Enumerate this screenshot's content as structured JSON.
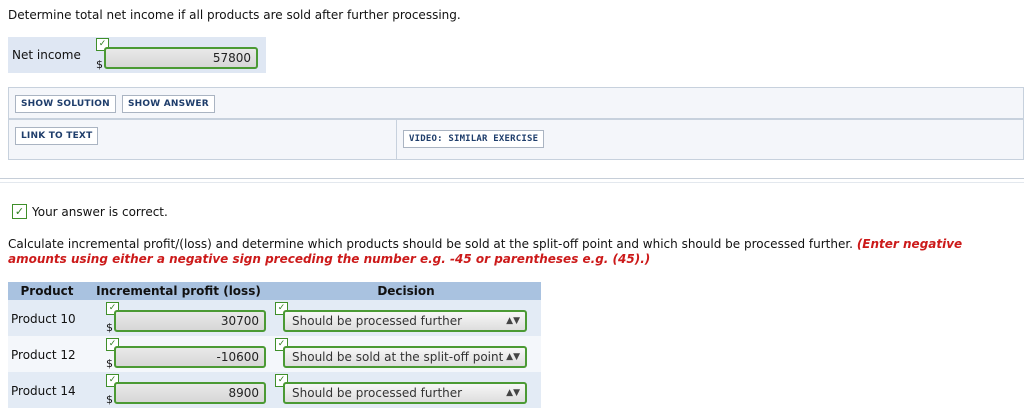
{
  "question1": "Determine total net income if all products are sold after further processing.",
  "net_income": {
    "label": "Net income",
    "currency": "$",
    "value": "57800"
  },
  "buttons": {
    "show_solution": "SHOW SOLUTION",
    "show_answer": "SHOW ANSWER",
    "link_to_text": "LINK TO TEXT",
    "video": "VIDEO: SIMILAR EXERCISE"
  },
  "correct_message": "Your answer is correct.",
  "instructions": {
    "main": "Calculate incremental profit/(loss) and determine which products should be sold at the split-off point and which should be processed further. ",
    "note": "(Enter negative amounts using either a negative sign preceding the number e.g. -45 or parentheses e.g. (45).)"
  },
  "table": {
    "headers": {
      "product": "Product",
      "incremental": "Incremental profit (loss)",
      "decision": "Decision"
    },
    "rows": [
      {
        "product": "Product 10",
        "currency": "$",
        "value": "30700",
        "decision": "Should be processed further"
      },
      {
        "product": "Product 12",
        "currency": "$",
        "value": "-10600",
        "decision": "Should be sold at the split-off point"
      },
      {
        "product": "Product 14",
        "currency": "$",
        "value": "8900",
        "decision": "Should be processed further"
      }
    ]
  },
  "colors": {
    "check_green": "#4b9a34",
    "header_blue": "#a9c2e0",
    "note_red": "#cc1a1a"
  }
}
